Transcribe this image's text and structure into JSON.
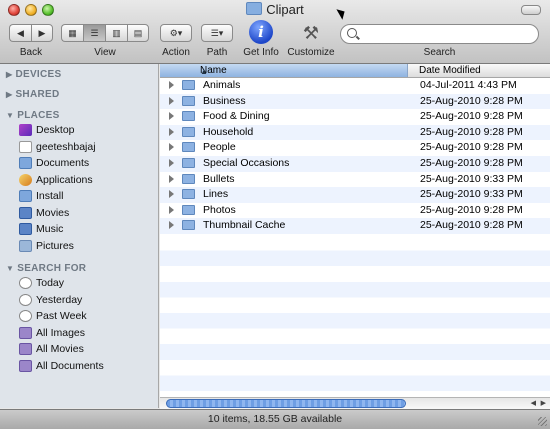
{
  "window": {
    "title": "Clipart"
  },
  "toolbar": {
    "back_label": "Back",
    "view_label": "View",
    "action_label": "Action",
    "path_label": "Path",
    "getinfo_label": "Get Info",
    "customize_label": "Customize",
    "search_label": "Search",
    "search_placeholder": ""
  },
  "sidebar": {
    "devices_label": "DEVICES",
    "shared_label": "SHARED",
    "places_label": "PLACES",
    "places": [
      {
        "label": "Desktop",
        "icon": "desktop-icon"
      },
      {
        "label": "geeteshbajaj",
        "icon": "home-icon"
      },
      {
        "label": "Documents",
        "icon": "documents-icon"
      },
      {
        "label": "Applications",
        "icon": "applications-icon"
      },
      {
        "label": "Install",
        "icon": "folder-icon"
      },
      {
        "label": "Movies",
        "icon": "movies-icon"
      },
      {
        "label": "Music",
        "icon": "music-icon"
      },
      {
        "label": "Pictures",
        "icon": "pictures-icon"
      }
    ],
    "searchfor_label": "SEARCH FOR",
    "searches": [
      {
        "label": "Today",
        "icon": "clock-icon"
      },
      {
        "label": "Yesterday",
        "icon": "clock-icon"
      },
      {
        "label": "Past Week",
        "icon": "clock-icon"
      },
      {
        "label": "All Images",
        "icon": "smart-folder-icon"
      },
      {
        "label": "All Movies",
        "icon": "smart-folder-icon"
      },
      {
        "label": "All Documents",
        "icon": "smart-folder-icon"
      }
    ]
  },
  "list": {
    "columns": {
      "name": "Name",
      "date": "Date Modified"
    },
    "rows": [
      {
        "name": "Animals",
        "date": "04-Jul-2011 4:43 PM"
      },
      {
        "name": "Business",
        "date": "25-Aug-2010 9:28 PM"
      },
      {
        "name": "Food & Dining",
        "date": "25-Aug-2010 9:28 PM"
      },
      {
        "name": "Household",
        "date": "25-Aug-2010 9:28 PM"
      },
      {
        "name": "People",
        "date": "25-Aug-2010 9:28 PM"
      },
      {
        "name": "Special Occasions",
        "date": "25-Aug-2010 9:28 PM"
      },
      {
        "name": "Bullets",
        "date": "25-Aug-2010 9:33 PM"
      },
      {
        "name": "Lines",
        "date": "25-Aug-2010 9:33 PM"
      },
      {
        "name": "Photos",
        "date": "25-Aug-2010 9:28 PM"
      },
      {
        "name": "Thumbnail Cache",
        "date": "25-Aug-2010 9:28 PM"
      }
    ]
  },
  "status": {
    "text": "10 items, 18.55 GB available"
  }
}
